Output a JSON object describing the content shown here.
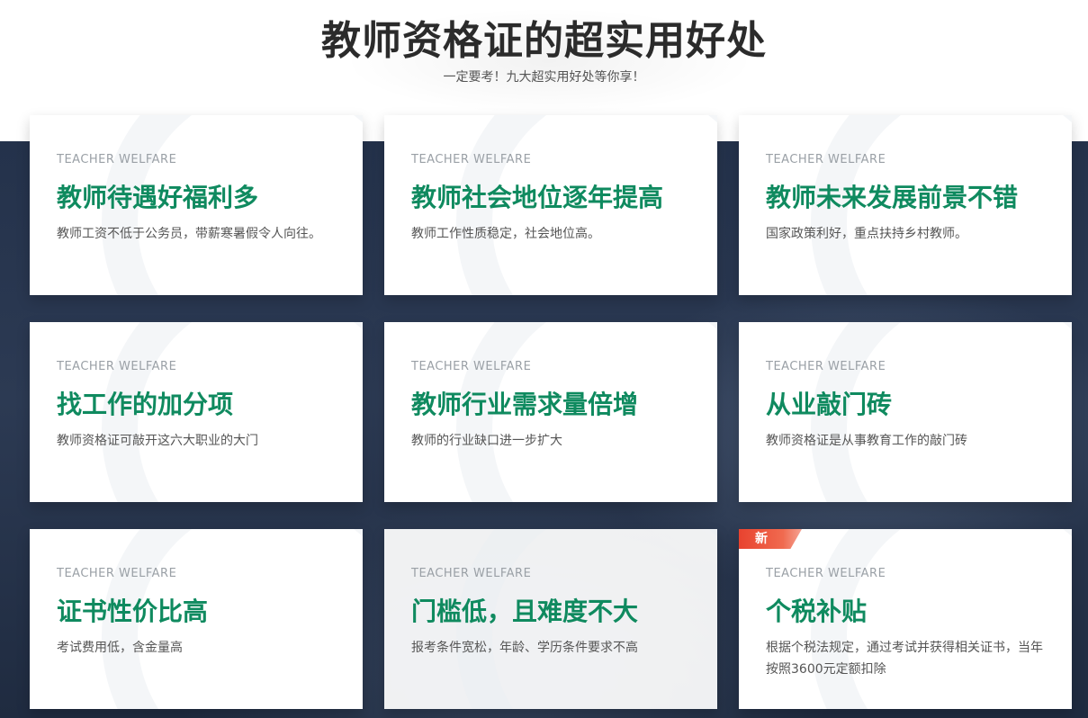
{
  "header": {
    "title": "教师资格证的超实用好处",
    "subtitle": "一定要考！九大超实用好处等你享！"
  },
  "cards": [
    {
      "tag": "TEACHER WELFARE",
      "title": "教师待遇好福利多",
      "desc": "教师工资不低于公务员，带薪寒暑假令人向往。"
    },
    {
      "tag": "TEACHER WELFARE",
      "title": "教师社会地位逐年提高",
      "desc": "教师工作性质稳定，社会地位高。"
    },
    {
      "tag": "TEACHER WELFARE",
      "title": "教师未来发展前景不错",
      "desc": "国家政策利好，重点扶持乡村教师。"
    },
    {
      "tag": "TEACHER WELFARE",
      "title": "找工作的加分项",
      "desc": "教师资格证可敲开这六大职业的大门"
    },
    {
      "tag": "TEACHER WELFARE",
      "title": "教师行业需求量倍增",
      "desc": "教师的行业缺口进一步扩大"
    },
    {
      "tag": "TEACHER WELFARE",
      "title": "从业敲门砖",
      "desc": "教师资格证是从事教育工作的敲门砖"
    },
    {
      "tag": "TEACHER WELFARE",
      "title": "证书性价比高",
      "desc": "考试费用低，含金量高"
    },
    {
      "tag": "TEACHER WELFARE",
      "title": "门槛低，且难度不大",
      "desc": "报考条件宽松，年龄、学历条件要求不高"
    },
    {
      "tag": "TEACHER WELFARE",
      "title": "个税补贴",
      "desc": "根据个税法规定，通过考试并获得相关证书，当年按照3600元定额扣除",
      "badge": "新"
    }
  ],
  "colors": {
    "accent": "#0f8a5f",
    "title": "#2b2b2b",
    "badge": "#e8432f",
    "background_dark": "#24324b"
  }
}
